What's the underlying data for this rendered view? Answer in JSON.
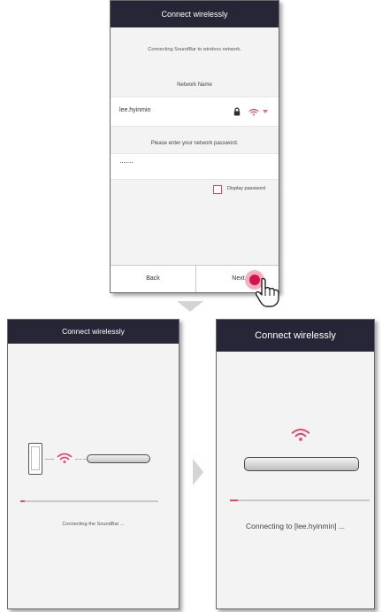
{
  "top_screen": {
    "title": "Connect wirelessly",
    "intro": "Connecting SoundBar to wireless network.",
    "network_label": "Network Name",
    "network_name": "lee.hyinmin",
    "password_label": "Please enter your network password.",
    "password_value": "·······",
    "display_password_label": "Display password",
    "display_password_checked": false,
    "back_label": "Back",
    "next_label": "Next"
  },
  "left_screen": {
    "title": "Connect wirelessly",
    "status": "Connecting the SoundBar ...",
    "progress": 0.03
  },
  "right_screen": {
    "title": "Connect wirelessly",
    "status": "Connecting to [lee.hyinmin] ...",
    "progress": 0.06
  },
  "colors": {
    "title_bar": "#262636",
    "accent": "#e3466f",
    "tap": "#d8114d"
  },
  "icons": [
    "lock-icon",
    "wifi-icon",
    "dropdown-arrow-icon",
    "pointing-hand-icon",
    "phone-icon",
    "soundbar-icon",
    "arrow-down-icon",
    "arrow-right-icon"
  ]
}
